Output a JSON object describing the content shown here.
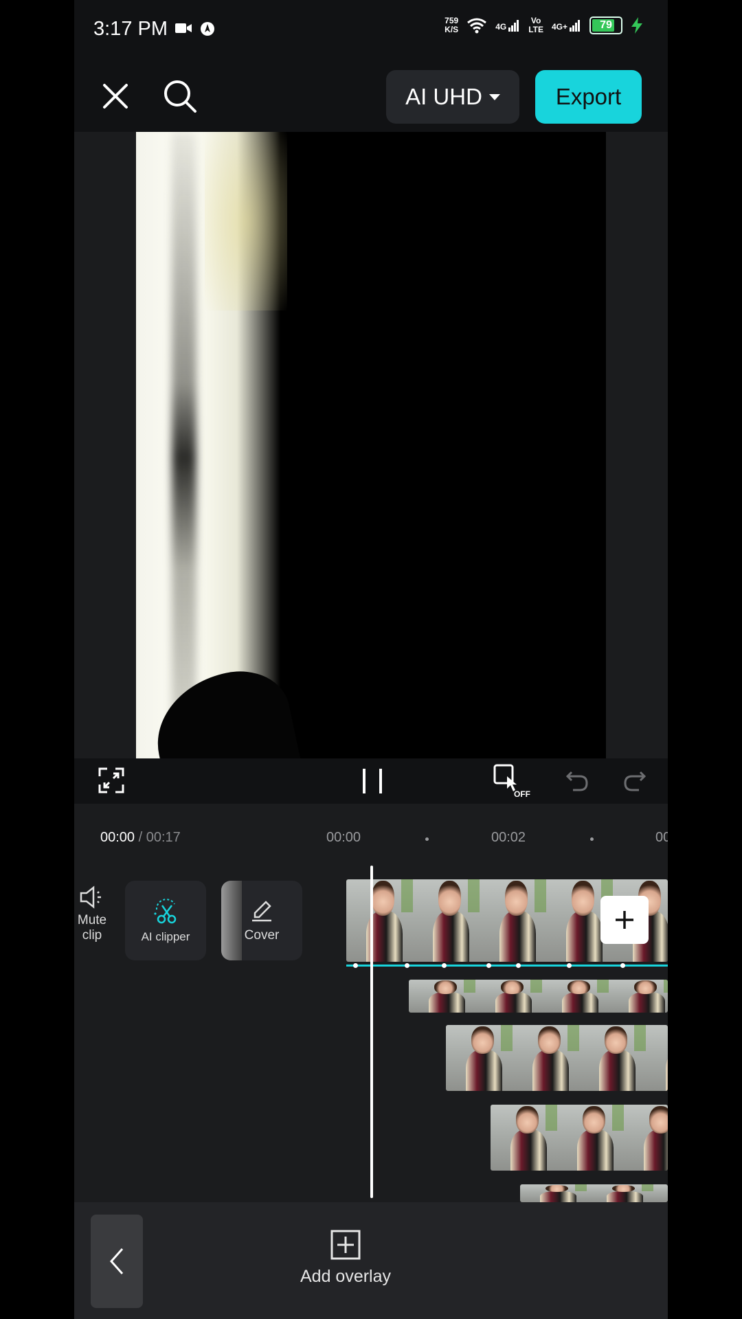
{
  "status_bar": {
    "time": "3:17 PM",
    "net_speed_value": "759",
    "net_speed_unit": "K/S",
    "net_4g": "4G",
    "volte_top": "Vo",
    "volte_bottom": "LTE",
    "net_4g_plus": "4G+",
    "battery_percent": "79",
    "battery_level": 0.79
  },
  "toolbar": {
    "quality_label": "AI UHD",
    "export_label": "Export"
  },
  "timeline": {
    "current_time": "00:00",
    "separator": "/",
    "total_time": "00:17",
    "ruler_marks": [
      "00:00",
      "00:02",
      "00"
    ]
  },
  "tools": {
    "mute_label_line1": "Mute",
    "mute_label_line2": "clip",
    "ai_clipper_label": "AI clipper",
    "cover_label": "Cover"
  },
  "bottom": {
    "add_overlay_label": "Add overlay"
  },
  "colors": {
    "accent": "#18d4dc",
    "background": "#111214",
    "panel": "#1b1c1e"
  }
}
